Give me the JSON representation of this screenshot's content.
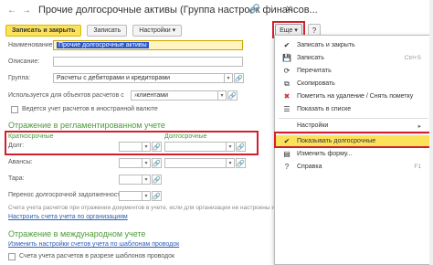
{
  "title": "Прочие долгосрочные активы (Группа настроек финансов...",
  "toolbar": {
    "save_close": "Записать и закрыть",
    "save": "Записать",
    "settings": "Настройки",
    "more": "Еще",
    "help": "?"
  },
  "form": {
    "name_label": "Наименование:",
    "name_value": "Прочие долгосрочные активы",
    "description_label": "Описание:",
    "group_label": "Группа:",
    "group_value": "Расчеты с дебиторами и кредиторами",
    "used_for_label": "Используется для объектов расчетов с",
    "used_for_value": "клиентами",
    "foreign_currency_label": "Ведется учет расчетов в иностранной валюте",
    "reg_section": "Отражение в регламентированном учете",
    "short_term": "Краткосрочные",
    "long_term": "Долгосрочные",
    "debt_label": "Долг:",
    "advances_label": "Авансы:",
    "tare_label": "Тара:",
    "transfer_label": "Перенос долгосрочной задолженности:",
    "note": "Счета учета расчетов при отражении документов в учете, если для организации не настроены исключения.",
    "org_link": "Настроить счета учета по организациям",
    "intl_section": "Отражение в международном учете",
    "intl_link": "Изменить настройки счетов учета по шаблонам проводок",
    "analytics_label": "Счета учета расчетов в разрезе шаблонов проводок"
  },
  "menu": {
    "items": [
      {
        "icon": "save-close-icon",
        "label": "Записать и закрыть",
        "shortcut": "",
        "checked": true
      },
      {
        "icon": "save-icon",
        "label": "Записать",
        "shortcut": "Ctrl+S",
        "checked": false
      },
      {
        "icon": "reread-icon",
        "label": "Перечитать",
        "shortcut": "",
        "checked": false
      },
      {
        "icon": "copy-icon",
        "label": "Скопировать",
        "shortcut": "",
        "checked": false
      },
      {
        "icon": "mark-delete-icon",
        "label": "Пометить на удаление / Снять пометку",
        "shortcut": "",
        "checked": false
      },
      {
        "icon": "show-list-icon",
        "label": "Показать в списке",
        "shortcut": "",
        "checked": false
      },
      {
        "icon": "settings-icon",
        "label": "Настройки",
        "shortcut": "",
        "checked": false
      },
      {
        "icon": "check-icon",
        "label": "Показывать долгосрочные",
        "shortcut": "",
        "checked": true
      },
      {
        "icon": "edit-form-icon",
        "label": "Изменить форму...",
        "shortcut": "",
        "checked": false
      },
      {
        "icon": "help-icon",
        "label": "Справка",
        "shortcut": "F1",
        "checked": false
      }
    ]
  },
  "colors": {
    "accent": "#fbe25a",
    "highlight_border": "#d0202e",
    "section": "#4c9a39",
    "link": "#2c5fb7"
  }
}
